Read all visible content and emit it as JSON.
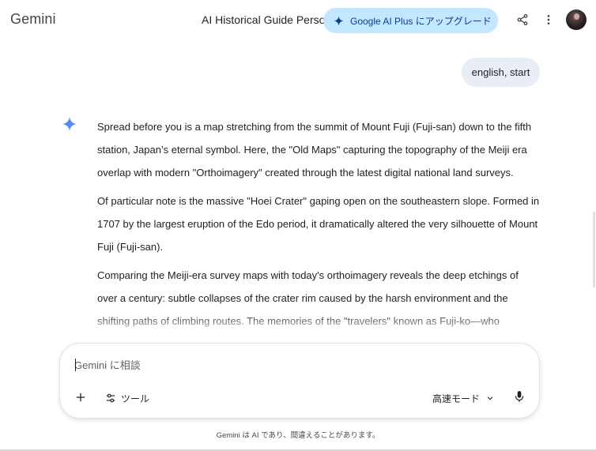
{
  "header": {
    "brand": "Gemini",
    "conversation_title": "AI Historical Guide Persona",
    "upgrade_label": "Google AI Plus にアップグレード"
  },
  "conversation": {
    "user_message": "english, start",
    "response_paragraphs": [
      "Spread before you is a map stretching from the summit of Mount Fuji (Fuji-san) down to the fifth station, Japan’s eternal symbol. Here, the \"Old Maps\" capturing the topography of the Meiji era overlap with modern \"Orthoimagery\" created through the latest digital national land surveys.",
      "Of particular note is the massive \"Hoei Crater\" gaping open on the southeastern slope. Formed in 1707 by the largest eruption of the Edo period, it dramatically altered the very silhouette of Mount Fuji (Fuji-san).",
      "Comparing the Meiji-era survey maps with today's orthoimagery reveals the deep etchings of over a century: subtle collapses of the crater rim caused by the harsh environment and the shifting paths of climbing routes. The memories of the \"travelers\" known as Fuji-ko—who"
    ]
  },
  "composer": {
    "placeholder": "Gemini に相談",
    "value": "",
    "tools_label": "ツール",
    "mode_label": "高速モード"
  },
  "footer": {
    "disclaimer": "Gemini は AI であり、間違えることがあります。"
  },
  "colors": {
    "accent": "#4285f4",
    "upgrade_bg": "#c2e7ff",
    "user_bubble_bg": "#e9eef6"
  },
  "icons": {
    "share": "share-icon",
    "more": "more-vert-icon",
    "plus": "plus-icon",
    "tools": "tools-icon",
    "chevron": "chevron-down-icon",
    "mic": "mic-icon",
    "spark": "gemini-spark-icon"
  }
}
